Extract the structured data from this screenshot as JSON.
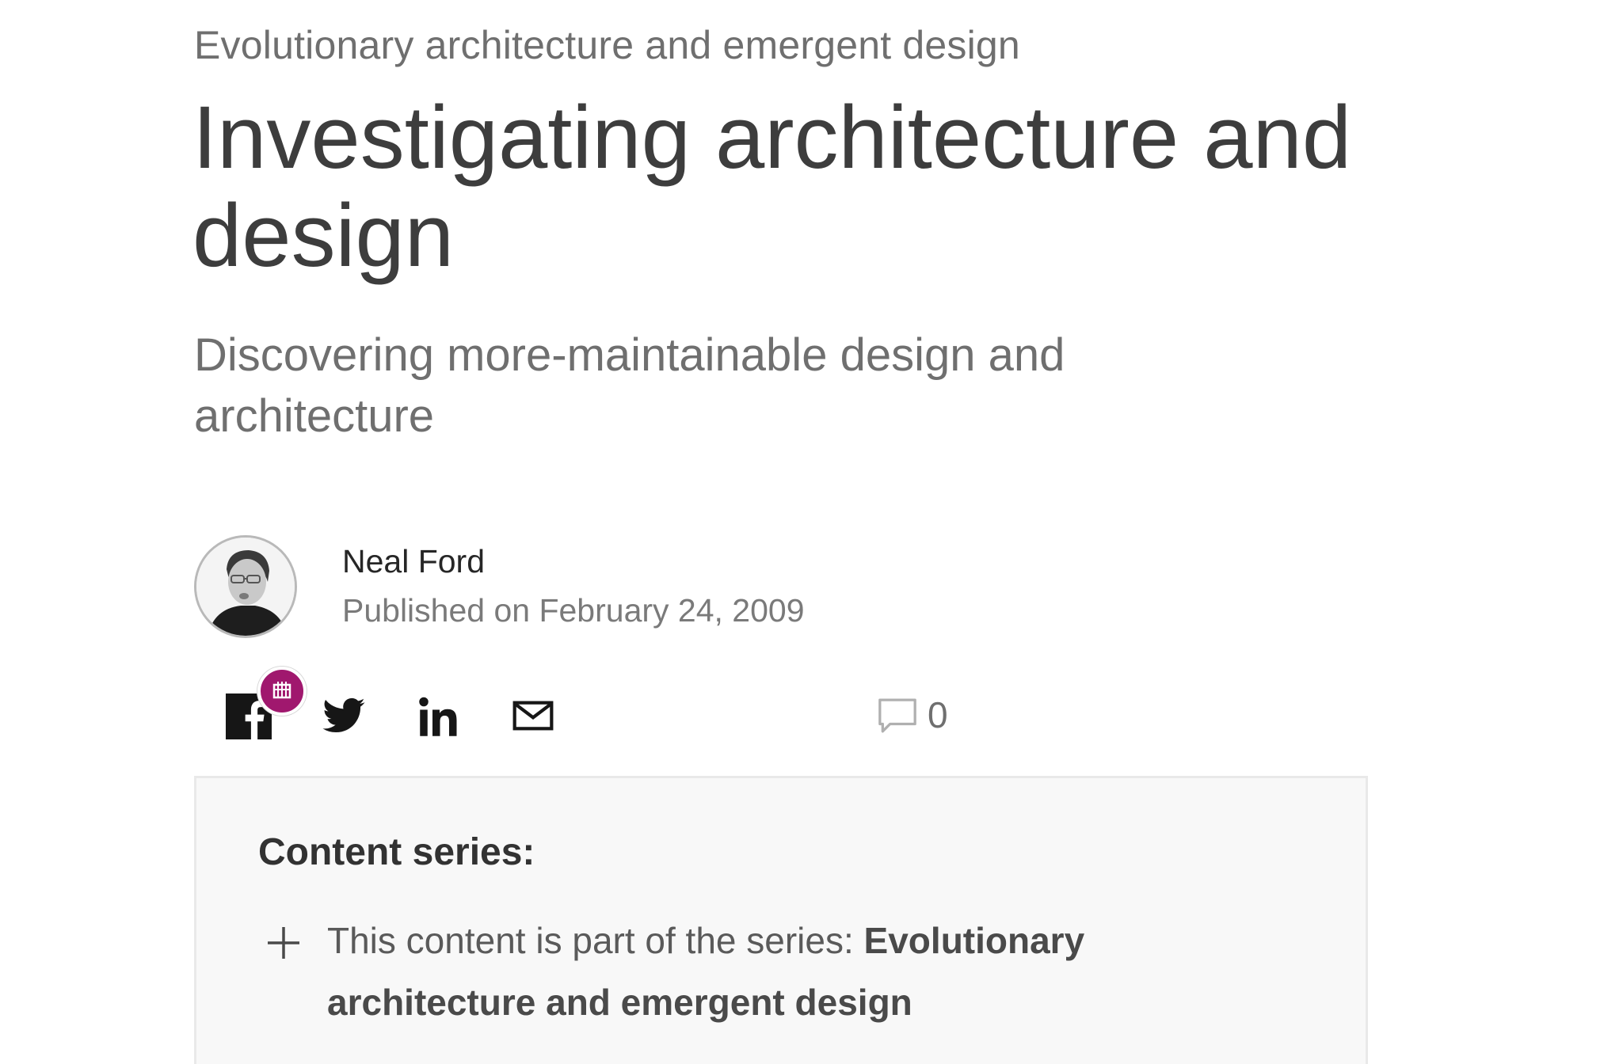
{
  "header": {
    "series_eyebrow": "Evolutionary architecture and emergent design",
    "title": "Investigating architecture and design",
    "subtitle": "Discovering more-maintainable design and architecture"
  },
  "author": {
    "name": "Neal Ford",
    "published": "Published on February 24, 2009",
    "avatar_icon": "author-photo"
  },
  "share": {
    "icons": [
      "facebook-icon",
      "twitter-icon",
      "linkedin-icon",
      "email-icon"
    ],
    "badge_icon": "calendar-badge-icon",
    "badge_color": "#a0186e",
    "comment_icon": "comment-icon",
    "comment_count": "0"
  },
  "content_series": {
    "heading": "Content series:",
    "toggle_icon": "plus-icon",
    "intro_text": "This content is part of the series: ",
    "series_name": "Evolutionary architecture and emergent design"
  },
  "colors": {
    "text_dark": "#3d3d3d",
    "text_muted": "#6f6f6f",
    "panel_bg": "#f8f8f8"
  }
}
